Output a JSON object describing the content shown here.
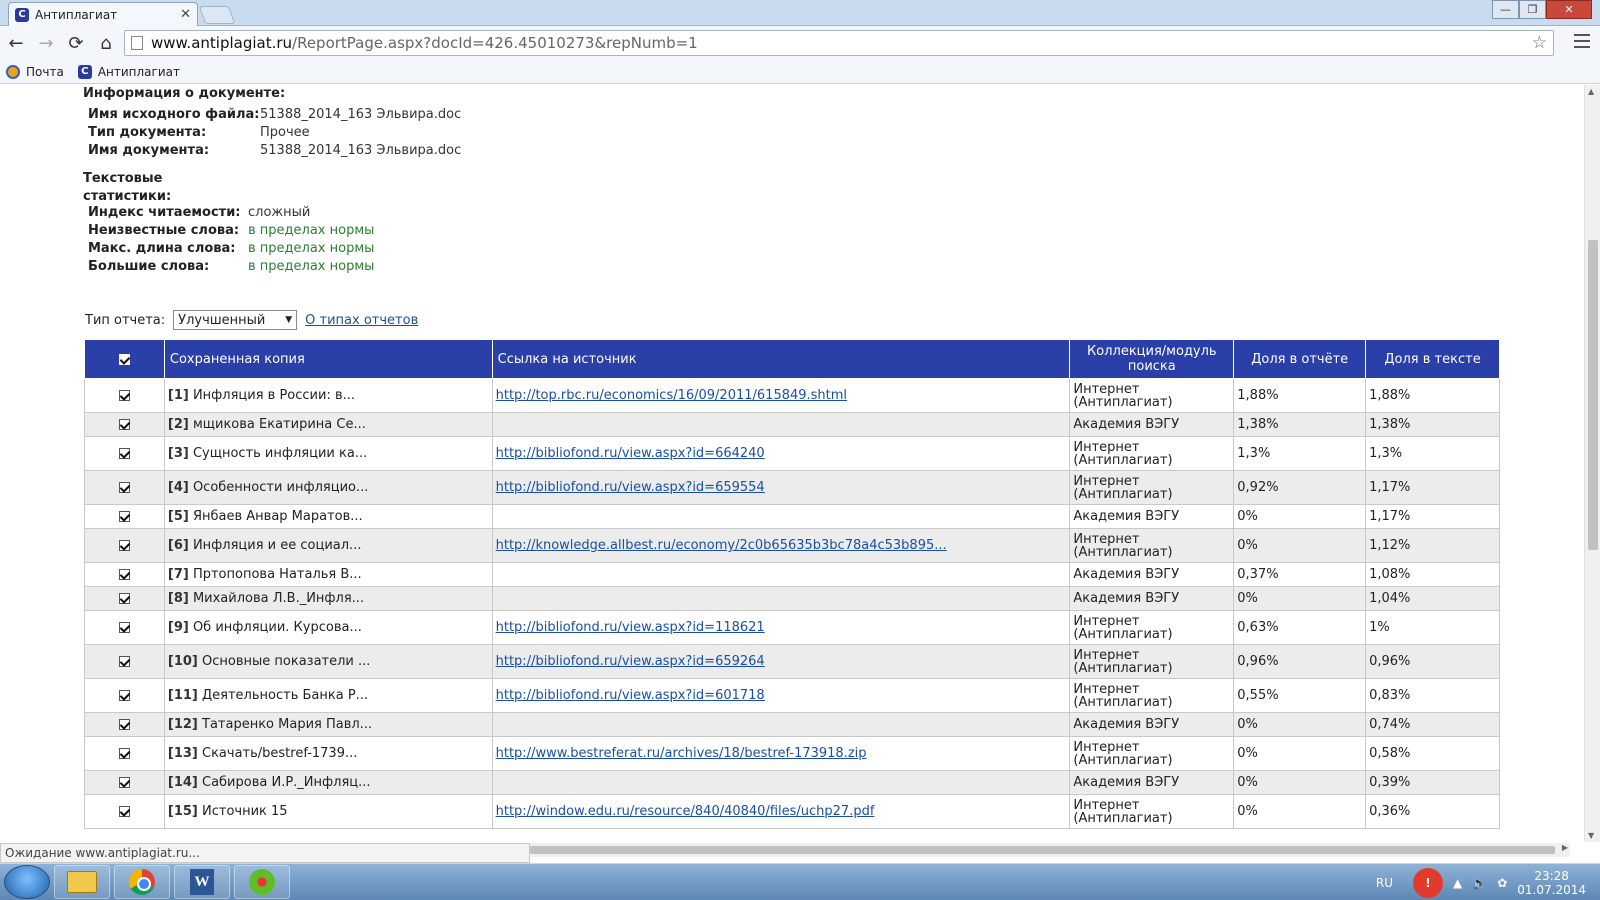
{
  "browser": {
    "tab_title": "Антиплагиат",
    "tab_close": "✕",
    "url_host": "www.antiplagiat.ru",
    "url_path": "/ReportPage.aspx?docId=426.45010273&repNumb=1",
    "back_glyph": "←",
    "forward_glyph": "→",
    "reload_glyph": "⟳",
    "home_glyph": "⌂",
    "star_glyph": "☆",
    "bookmarks": [
      "Почта",
      "Антиплагиат"
    ]
  },
  "doc_info": {
    "title": "Информация о документе:",
    "file_label": "Имя исходного файла:",
    "file_value": "51388_2014_163 Эльвира.doc",
    "type_label": "Тип документа:",
    "type_value": "Прочее",
    "name_label": "Имя документа:",
    "name_value": "51388_2014_163 Эльвира.doc"
  },
  "stats": {
    "title_line1": "Текстовые",
    "title_line2": "статистики:",
    "items": [
      {
        "label": "Индекс читаемости:",
        "value": "сложный"
      },
      {
        "label": "Неизвестные слова:",
        "value": "в пределах нормы"
      },
      {
        "label": "Макс. длина слова:",
        "value": "в пределах нормы"
      },
      {
        "label": "Большие слова:",
        "value": "в пределах нормы"
      }
    ]
  },
  "report_type": {
    "label": "Тип отчета:",
    "selected": "Улучшенный",
    "about_link": "О типах отчетов"
  },
  "table": {
    "headers": [
      "Сохраненная копия",
      "Ссылка на источник",
      "Коллекция/модуль поиска",
      "Доля в отчёте",
      "Доля в тексте"
    ],
    "rows": [
      {
        "idx": "[1]",
        "title": "Инфляция в России: в...",
        "url": "http://top.rbc.ru/economics/16/09/2011/615849.shtml",
        "coll": [
          "Интернет",
          "(Антиплагиат)"
        ],
        "report": "1,88%",
        "text": "1,88%"
      },
      {
        "idx": "[2]",
        "title": "мщикова Екатирина Се...",
        "url": "",
        "coll": [
          "Академия ВЭГУ"
        ],
        "report": "1,38%",
        "text": "1,38%"
      },
      {
        "idx": "[3]",
        "title": "Сущность инфляции ка...",
        "url": "http://bibliofond.ru/view.aspx?id=664240",
        "coll": [
          "Интернет",
          "(Антиплагиат)"
        ],
        "report": "1,3%",
        "text": "1,3%"
      },
      {
        "idx": "[4]",
        "title": "Особенности инфляцио...",
        "url": "http://bibliofond.ru/view.aspx?id=659554",
        "coll": [
          "Интернет",
          "(Антиплагиат)"
        ],
        "report": "0,92%",
        "text": "1,17%"
      },
      {
        "idx": "[5]",
        "title": "Янбаев Анвар Маратов...",
        "url": "",
        "coll": [
          "Академия ВЭГУ"
        ],
        "report": "0%",
        "text": "1,17%"
      },
      {
        "idx": "[6]",
        "title": "Инфляция и ее социал...",
        "url": "http://knowledge.allbest.ru/economy/2c0b65635b3bc78a4c53b895...",
        "coll": [
          "Интернет",
          "(Антиплагиат)"
        ],
        "report": "0%",
        "text": "1,12%"
      },
      {
        "idx": "[7]",
        "title": "Пртопопова Наталья В...",
        "url": "",
        "coll": [
          "Академия ВЭГУ"
        ],
        "report": "0,37%",
        "text": "1,08%"
      },
      {
        "idx": "[8]",
        "title": "Михайлова Л.В._Инфля...",
        "url": "",
        "coll": [
          "Академия ВЭГУ"
        ],
        "report": "0%",
        "text": "1,04%"
      },
      {
        "idx": "[9]",
        "title": "Об инфляции. Курсова...",
        "url": "http://bibliofond.ru/view.aspx?id=118621",
        "coll": [
          "Интернет",
          "(Антиплагиат)"
        ],
        "report": "0,63%",
        "text": "1%"
      },
      {
        "idx": "[10]",
        "title": "Основные показатели ...",
        "url": "http://bibliofond.ru/view.aspx?id=659264",
        "coll": [
          "Интернет",
          "(Антиплагиат)"
        ],
        "report": "0,96%",
        "text": "0,96%"
      },
      {
        "idx": "[11]",
        "title": "Деятельность Банка Р...",
        "url": "http://bibliofond.ru/view.aspx?id=601718",
        "coll": [
          "Интернет",
          "(Антиплагиат)"
        ],
        "report": "0,55%",
        "text": "0,83%"
      },
      {
        "idx": "[12]",
        "title": "Татаренко Мария Павл...",
        "url": "",
        "coll": [
          "Академия ВЭГУ"
        ],
        "report": "0%",
        "text": "0,74%"
      },
      {
        "idx": "[13]",
        "title": "Скачать/bestref-1739...",
        "url": "http://www.bestreferat.ru/archives/18/bestref-173918.zip",
        "coll": [
          "Интернет",
          "(Антиплагиат)"
        ],
        "report": "0%",
        "text": "0,58%"
      },
      {
        "idx": "[14]",
        "title": "Сабирова И.Р._Инфляц...",
        "url": "",
        "coll": [
          "Академия ВЭГУ"
        ],
        "report": "0%",
        "text": "0,39%"
      },
      {
        "idx": "[15]",
        "title": "Источник 15",
        "url": "http://window.edu.ru/resource/840/40840/files/uchp27.pdf",
        "coll": [
          "Интернет",
          "(Антиплагиат)"
        ],
        "report": "0%",
        "text": "0,36%"
      }
    ]
  },
  "status_bar": "Ожидание www.antiplagiat.ru...",
  "taskbar": {
    "lang": "RU",
    "time": "23:28",
    "date": "01.07.2014"
  }
}
